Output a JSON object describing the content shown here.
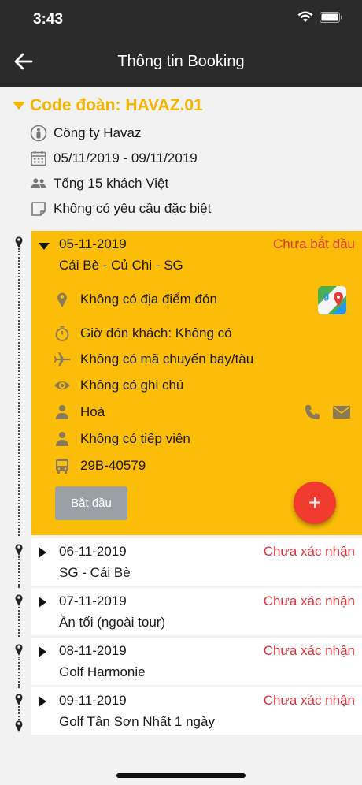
{
  "status_bar": {
    "time": "3:43"
  },
  "header": {
    "title": "Thông tin Booking"
  },
  "group": {
    "code": "Code đoàn: HAVAZ.01",
    "company": "Công ty Havaz",
    "dates": "05/11/2019 - 09/11/2019",
    "guests": "Tổng 15 khách Việt",
    "requests": "Không có yêu cầu đặc biệt"
  },
  "active_day": {
    "date": "05-11-2019",
    "route": "Cái Bè - Củ Chi - SG",
    "status": "Chưa bắt đầu",
    "pickup_place": "Không có địa điểm đón",
    "pickup_time": "Giờ đón khách: Không có",
    "flight": "Không có mã chuyến bay/tàu",
    "note": "Không có ghi chú",
    "driver": "Hoà",
    "guide": "Không có tiếp viên",
    "plate": "29B-40579",
    "start_label": "Bắt đầu",
    "fab_label": "+"
  },
  "days": [
    {
      "date": "06-11-2019",
      "route": "SG - Cái Bè",
      "status": "Chưa xác nhận"
    },
    {
      "date": "07-11-2019",
      "route": "Ăn tối (ngoài tour)",
      "status": "Chưa xác nhận"
    },
    {
      "date": "08-11-2019",
      "route": "Golf Harmonie",
      "status": "Chưa xác nhận"
    },
    {
      "date": "09-11-2019",
      "route": "Golf Tân Sơn Nhất 1 ngày",
      "status": "Chưa xác nhận"
    }
  ],
  "colors": {
    "accent": "#f4b400",
    "header": "#2b2b2b",
    "status_red": "#e0303a",
    "fab": "#f23b30"
  }
}
